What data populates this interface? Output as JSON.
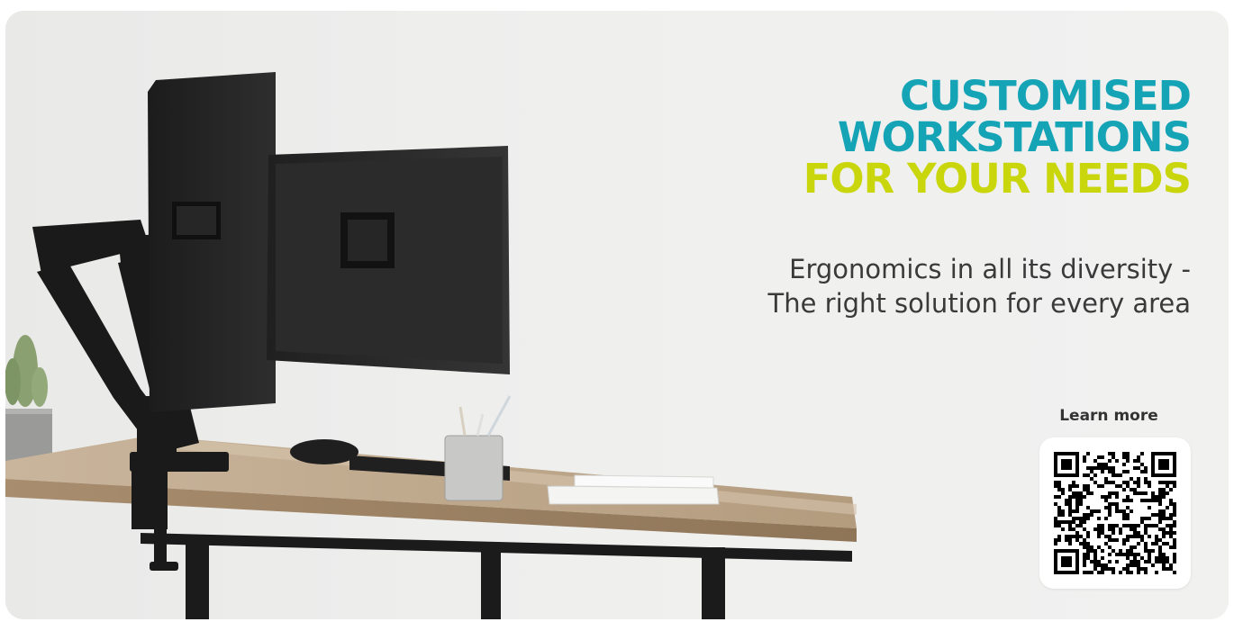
{
  "headline": {
    "line1": "CUSTOMISED",
    "line2": "WORKSTATIONS",
    "line3": "FOR YOUR NEEDS"
  },
  "subtitle": {
    "line1": "Ergonomics in all its diversity -",
    "line2": "The right solution for every area"
  },
  "cta": {
    "label": "Learn more"
  },
  "icons": {
    "qr": "qr-code-icon"
  },
  "colors": {
    "teal": "#15a3b6",
    "lime": "#cad60c",
    "text": "#3a3a3a",
    "background": "#eeeeed"
  }
}
